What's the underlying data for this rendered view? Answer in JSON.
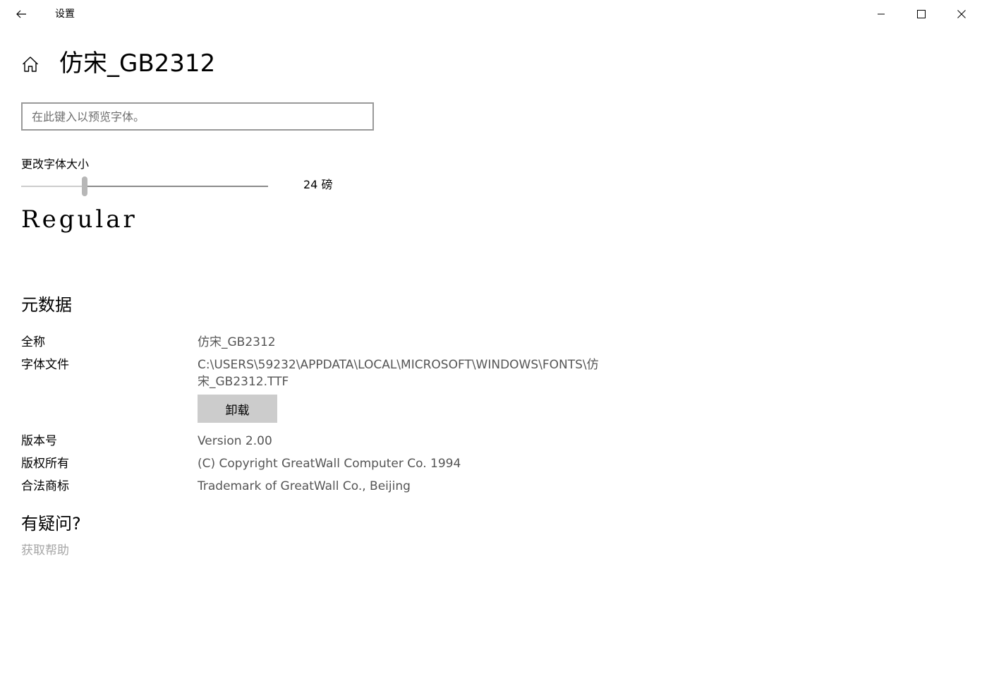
{
  "titlebar": {
    "app_title": "设置",
    "back_icon": "arrow-left-icon",
    "minimize_icon": "minimize-icon",
    "maximize_icon": "maximize-icon",
    "close_icon": "close-icon"
  },
  "header": {
    "home_icon": "home-icon",
    "title": "仿宋_GB2312"
  },
  "preview": {
    "placeholder": "在此键入以预览字体。",
    "value": ""
  },
  "size": {
    "label": "更改字体大小",
    "value_text": "24 磅",
    "slider_fraction": 0.257
  },
  "style_preview": {
    "text": "Regular"
  },
  "metadata": {
    "heading": "元数据",
    "full_name_label": "全称",
    "full_name_value": "仿宋_GB2312",
    "font_file_label": "字体文件",
    "font_file_value": "C:\\USERS\\59232\\APPDATA\\LOCAL\\MICROSOFT\\WINDOWS\\FONTS\\仿宋_GB2312.TTF",
    "uninstall_label": "卸载",
    "version_label": "版本号",
    "version_value": "Version 2.00",
    "copyright_label": "版权所有",
    "copyright_value": "(C) Copyright GreatWall Computer Co. 1994",
    "trademark_label": "合法商标",
    "trademark_value": "Trademark of GreatWall Co., Beijing"
  },
  "help": {
    "heading": "有疑问?",
    "link_label": "获取帮助"
  },
  "colors": {
    "background": "#ffffff",
    "text_primary": "#000000",
    "text_secondary": "#555555",
    "link_disabled": "#a6a6a6",
    "button_bg": "#cccccc",
    "input_border": "#999999"
  }
}
